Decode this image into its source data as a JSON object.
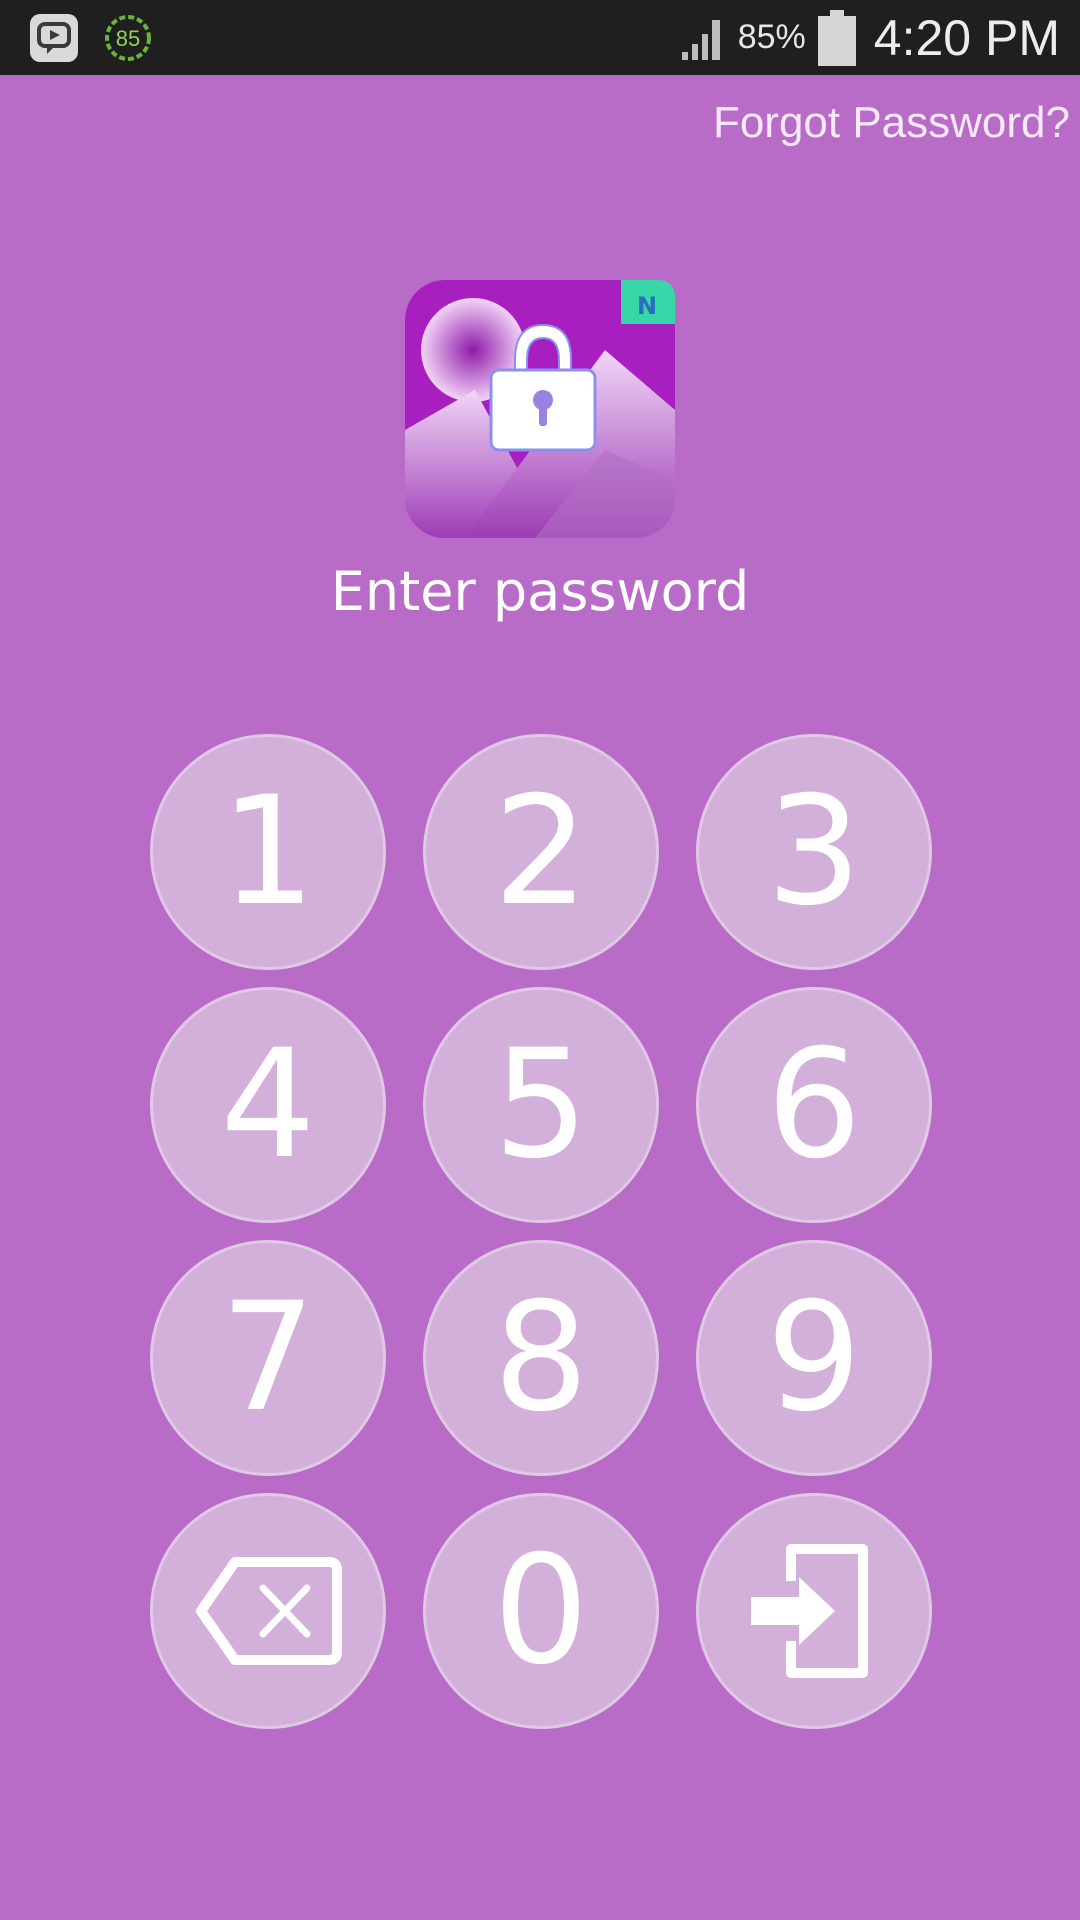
{
  "status_bar": {
    "notification_icons": [
      "chat-app-icon",
      "timer-85-icon"
    ],
    "timer_badge": "85",
    "battery_percent": "85%",
    "time": "4:20 PM"
  },
  "header": {
    "forgot_password_label": "Forgot Password?"
  },
  "app_icon": {
    "name": "gallery-lock-icon",
    "badge": "N"
  },
  "prompt": "Enter password",
  "keypad": {
    "keys": [
      "1",
      "2",
      "3",
      "4",
      "5",
      "6",
      "7",
      "8",
      "9",
      "0"
    ],
    "delete_icon": "backspace-icon",
    "enter_icon": "enter-icon"
  },
  "colors": {
    "background": "#b96bc8",
    "key_fill": "#d3b0da",
    "status_bar": "#1f1f1f"
  }
}
